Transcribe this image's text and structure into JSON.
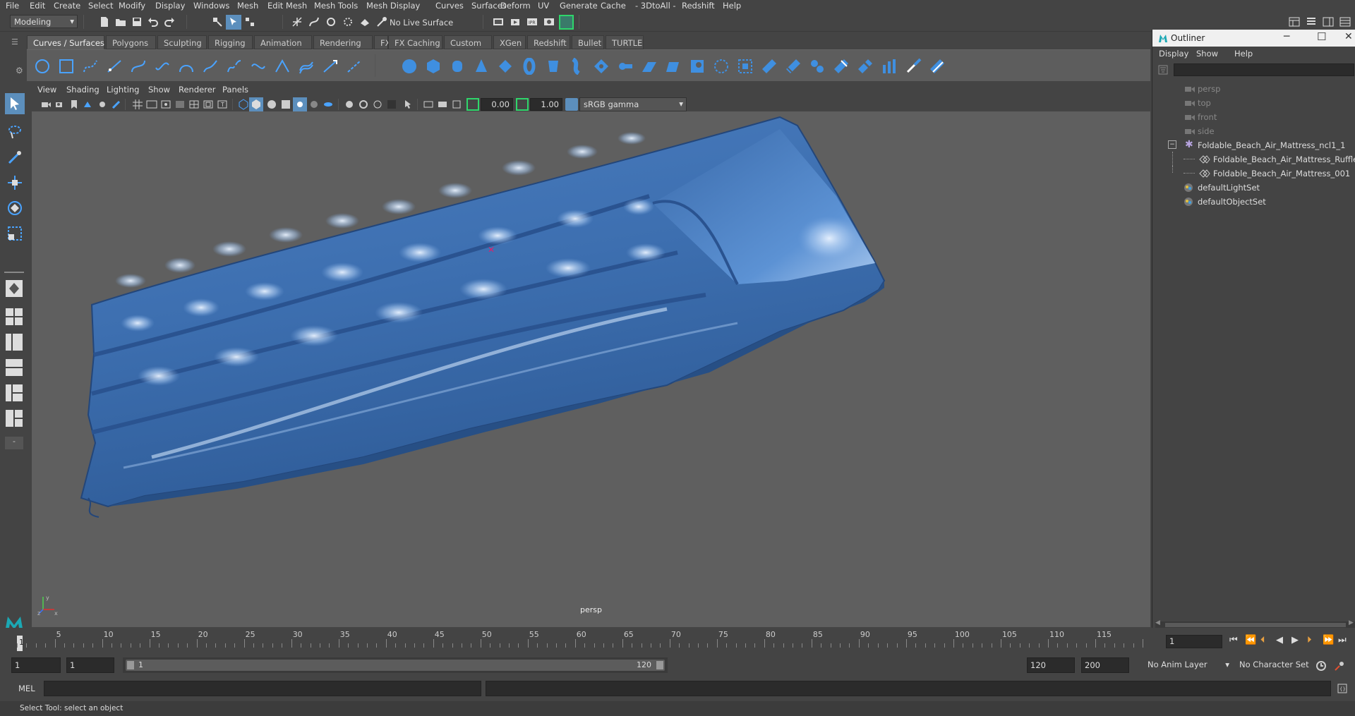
{
  "menubar": [
    "File",
    "Edit",
    "Create",
    "Select",
    "Modify",
    "Display",
    "Windows",
    "Mesh",
    "Edit Mesh",
    "Mesh Tools",
    "Mesh Display",
    "Curves",
    "Surfaces",
    "Deform",
    "UV",
    "Generate",
    "Cache",
    "- 3DtoAll -",
    "Redshift",
    "Help"
  ],
  "status": {
    "mode": "Modeling",
    "live_surface": "No Live Surface"
  },
  "shelf_tabs": [
    "Curves / Surfaces",
    "Polygons",
    "Sculpting",
    "Rigging",
    "Animation",
    "Rendering",
    "FX",
    "FX Caching",
    "Custom",
    "XGen",
    "Redshift",
    "Bullet",
    "TURTLE"
  ],
  "viewport": {
    "menu": [
      "View",
      "Shading",
      "Lighting",
      "Show",
      "Renderer",
      "Panels"
    ],
    "exposure": "0.00",
    "gamma": "1.00",
    "color_space": "sRGB gamma",
    "camera_label": "persp"
  },
  "outliner": {
    "title": "Outliner",
    "menu": [
      "Display",
      "Show",
      "Help"
    ],
    "items": [
      {
        "label": "persp",
        "type": "camera"
      },
      {
        "label": "top",
        "type": "camera"
      },
      {
        "label": "front",
        "type": "camera"
      },
      {
        "label": "side",
        "type": "camera"
      },
      {
        "label": "Foldable_Beach_Air_Mattress_ncl1_1",
        "type": "ncloth"
      },
      {
        "label": "Foldable_Beach_Air_Mattress_Ruffles",
        "type": "mesh"
      },
      {
        "label": "Foldable_Beach_Air_Mattress_001",
        "type": "mesh"
      },
      {
        "label": "defaultLightSet",
        "type": "set"
      },
      {
        "label": "defaultObjectSet",
        "type": "set"
      }
    ]
  },
  "timeline": {
    "ticks": [
      "5",
      "10",
      "15",
      "20",
      "25",
      "30",
      "35",
      "40",
      "45",
      "50",
      "55",
      "60",
      "65",
      "70",
      "75",
      "80",
      "85",
      "90",
      "95",
      "100",
      "105",
      "110",
      "115"
    ],
    "first_tick": "1",
    "current_frame": "1"
  },
  "range": {
    "start": "1",
    "playback_start": "1",
    "slider_start": "1",
    "slider_end": "120",
    "playback_end": "120",
    "end": "200",
    "anim_layer": "No Anim Layer",
    "character_set": "No Character Set"
  },
  "command_line": {
    "lang": "MEL"
  },
  "help_line": "Select Tool: select an object",
  "colors": {
    "mesh": "#3d6fb0",
    "viewport_bg": "#5f5f5f",
    "ui_bg": "#444444"
  }
}
